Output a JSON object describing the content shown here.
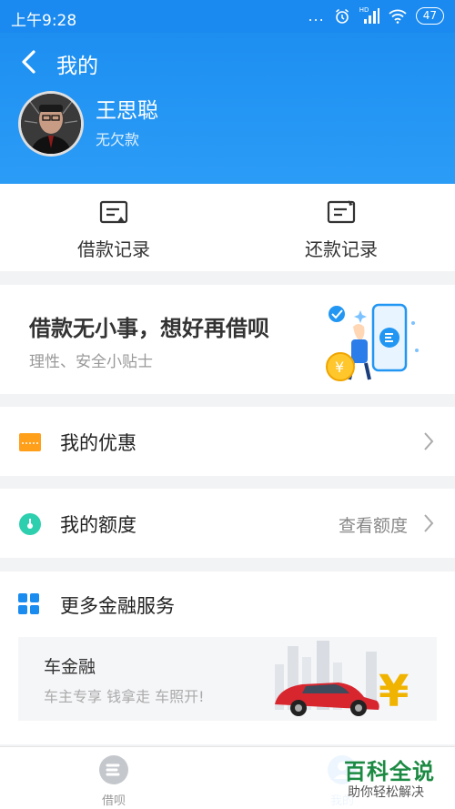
{
  "status_bar": {
    "time": "上午9:28",
    "battery": "47",
    "dots": "...",
    "hd": "HD"
  },
  "header": {
    "title": "我的"
  },
  "user": {
    "name": "王思聪",
    "status": "无欠款"
  },
  "records": {
    "borrow_label": "借款记录",
    "repay_label": "还款记录"
  },
  "banner": {
    "title": "借款无小事，想好再借呗",
    "subtitle": "理性、安全小贴士"
  },
  "menu": {
    "coupons_label": "我的优惠",
    "quota_label": "我的额度",
    "quota_value": "查看额度"
  },
  "services": {
    "title": "更多金融服务",
    "car_title": "车金融",
    "car_subtitle": "车主专享 钱拿走 车照开!"
  },
  "tabbar": {
    "borrow_label": "借呗",
    "mine_label": "我的"
  },
  "watermark": {
    "title": "百科全说",
    "subtitle": "助你轻松解决"
  },
  "colors": {
    "brand_blue": "#1a8cf0",
    "coupon_orange": "#ff9f1a",
    "quota_teal": "#2ecfae",
    "watermark_green": "#1c8a43"
  }
}
